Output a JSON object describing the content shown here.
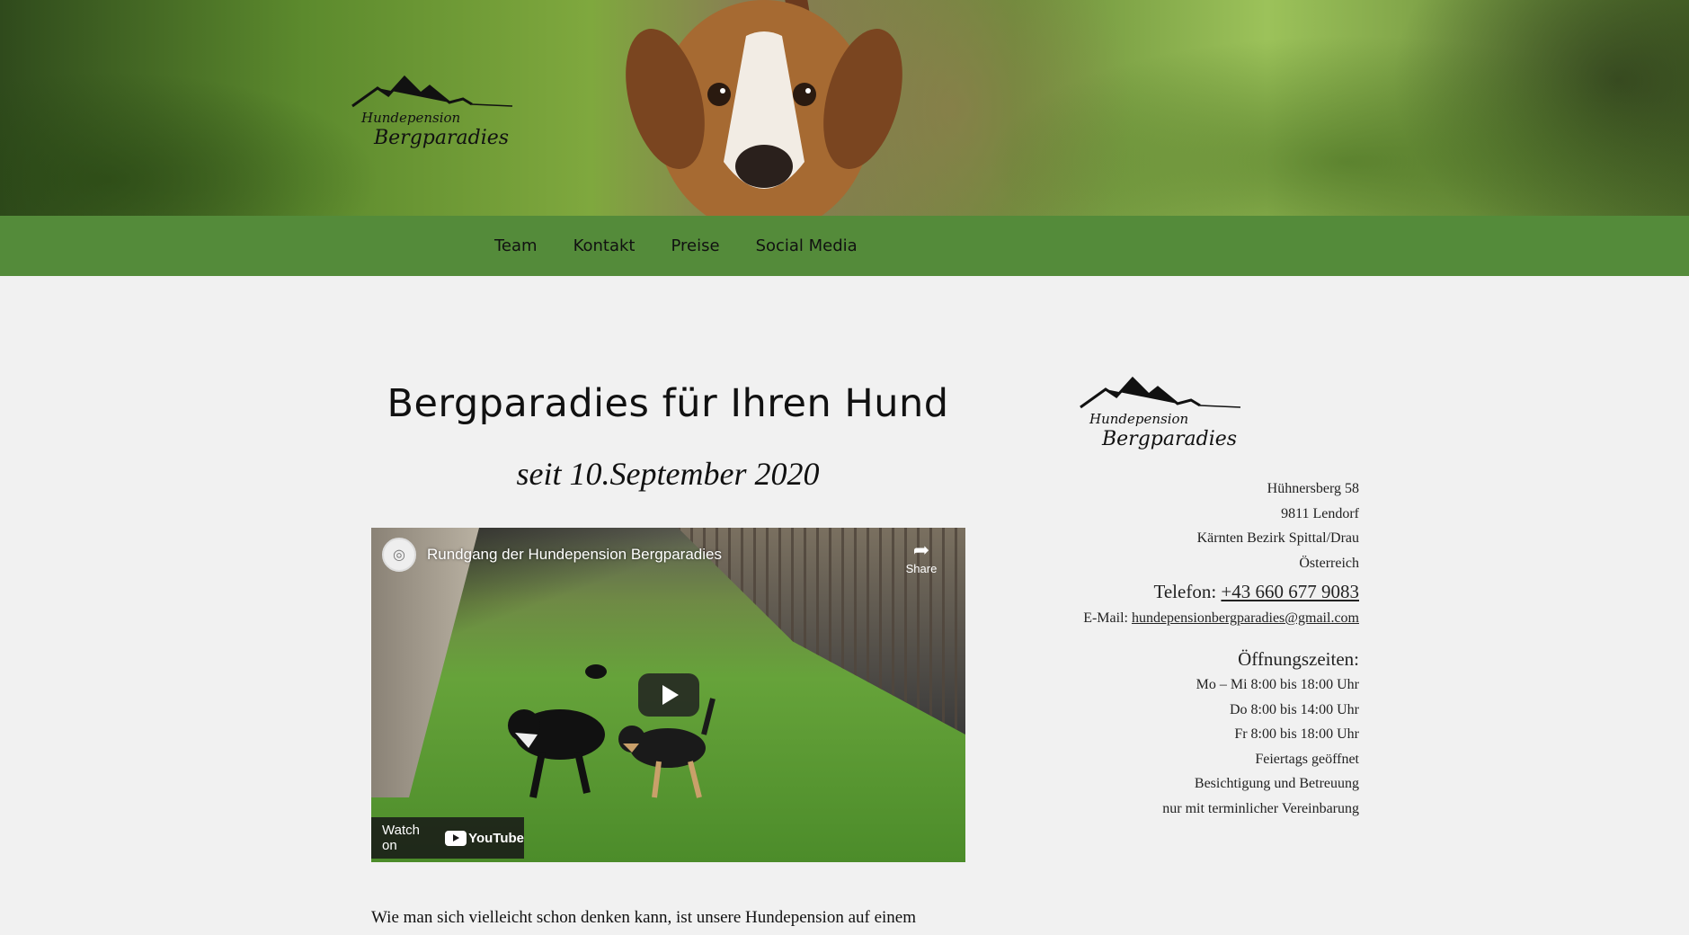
{
  "header": {
    "logo_text_line1": "Hundepension",
    "logo_text_line2": "Bergparadies"
  },
  "nav": {
    "items": [
      {
        "label": "Team"
      },
      {
        "label": "Kontakt"
      },
      {
        "label": "Preise"
      },
      {
        "label": "Social Media"
      }
    ]
  },
  "main": {
    "title": "Bergparadies für Ihren Hund",
    "subtitle": "seit 10.September 2020",
    "video": {
      "title": "Rundgang der Hundepension Bergparadies",
      "share_label": "Share",
      "watch_on_label": "Watch on",
      "youtube_label": "YouTube"
    },
    "intro_text": "Wie man sich vielleicht schon denken kann, ist unsere Hundepension auf einem"
  },
  "sidebar": {
    "logo_text_line1": "Hundepension",
    "logo_text_line2": "Bergparadies",
    "address": [
      "Hühnersberg 58",
      "9811 Lendorf",
      "Kärnten Bezirk Spittal/Drau",
      "Österreich"
    ],
    "phone_label": "Telefon: ",
    "phone_value": "+43 660 677 9083",
    "email_label": "E-Mail: ",
    "email_value": "hundepensionbergparadies@gmail.com",
    "hours_title": "Öffnungszeiten:",
    "hours": [
      "Mo – Mi 8:00 bis 18:00 Uhr",
      "Do 8:00 bis 14:00 Uhr",
      "Fr 8:00 bis 18:00 Uhr",
      "Feiertags geöffnet",
      "Besichtigung und Betreuung",
      "nur mit terminlicher Vereinbarung"
    ]
  },
  "colors": {
    "nav_bg": "#548b3a",
    "page_bg": "#f1f1f1"
  }
}
